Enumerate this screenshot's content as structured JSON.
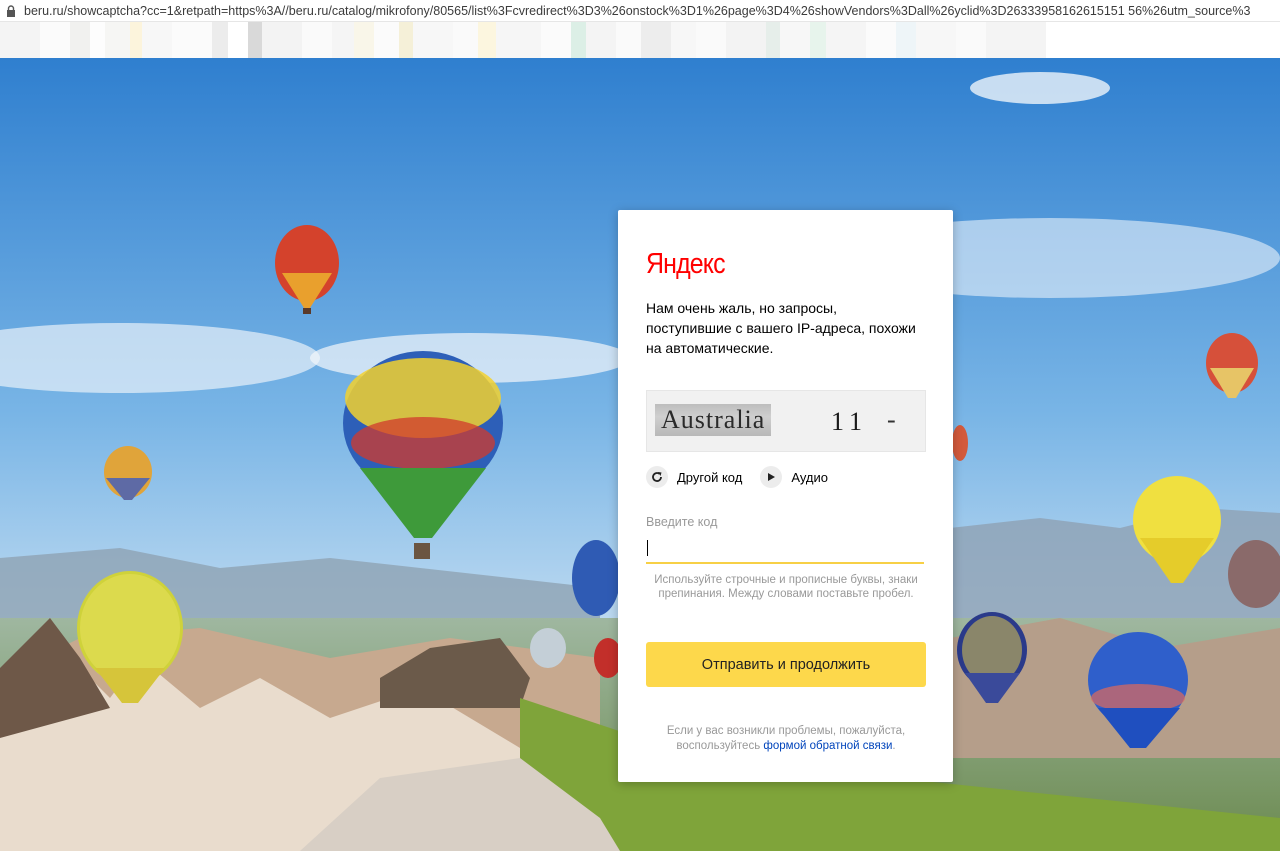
{
  "browser": {
    "url": "beru.ru/showcaptcha?cc=1&retpath=https%3A//beru.ru/catalog/mikrofony/80565/list%3Fcvredirect%3D3%26onstock%3D1%26page%3D4%26showVendors%3Dall%26yclid%3D26333958162615151 56%26utm_source%3"
  },
  "captcha": {
    "logo": "Яндекс",
    "message": "Нам очень жаль, но запросы, поступившие с вашего IP-адреса, похожи на автоматические.",
    "image_word": "Australia",
    "image_number": "11",
    "image_dash": "-",
    "refresh_label": "Другой код",
    "audio_label": "Аудио",
    "input_label": "Введите код",
    "input_value": "",
    "hint": "Используйте строчные и прописные буквы, знаки препинания. Между словами поставьте пробел.",
    "submit_label": "Отправить и продолжить",
    "footer_text": "Если у вас возникли проблемы, пожалуйста, воспользуйтесь",
    "footer_link": "формой обратной связи",
    "footer_end": "."
  },
  "colors": {
    "brand_red": "#ff0000",
    "button_yellow": "#fdd84b",
    "link_blue": "#0044bb"
  }
}
